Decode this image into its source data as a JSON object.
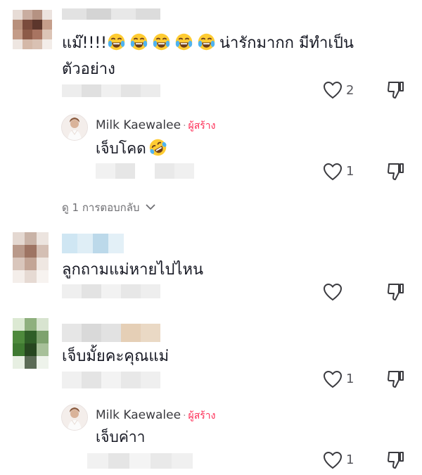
{
  "comments": [
    {
      "text_line1": "แม๊!!!!",
      "text_line1_tail": "น่ารักมากก มีทำเป็น",
      "text_line2": "ตัวอย่าง",
      "like_count": "2",
      "reply": {
        "username": "Milk Kaewalee",
        "badge": "ผู้สร้าง",
        "text": "เจ็บโคด",
        "like_count": "1"
      },
      "view_replies": "ดู 1 การตอบกลับ"
    },
    {
      "text": "ลูกถามแม่หายไปไหน",
      "like_count": ""
    },
    {
      "text": "เจ็บมั้ยคะคุณแม่",
      "like_count": "1",
      "reply": {
        "username": "Milk Kaewalee",
        "badge": "ผู้สร้าง",
        "text": "เจ็บค่าา",
        "like_count": "1"
      }
    }
  ],
  "icons": {
    "like": "heart-outline-icon",
    "dislike": "thumbs-down-icon",
    "expand": "chevron-down-icon",
    "emoji_laugh": "tears-of-joy-emoji",
    "emoji_rofl": "rolling-on-floor-laughing-emoji"
  },
  "colors": {
    "creator_badge": "#fe2c55",
    "text": "#161823",
    "meta": "#6f6f73"
  }
}
